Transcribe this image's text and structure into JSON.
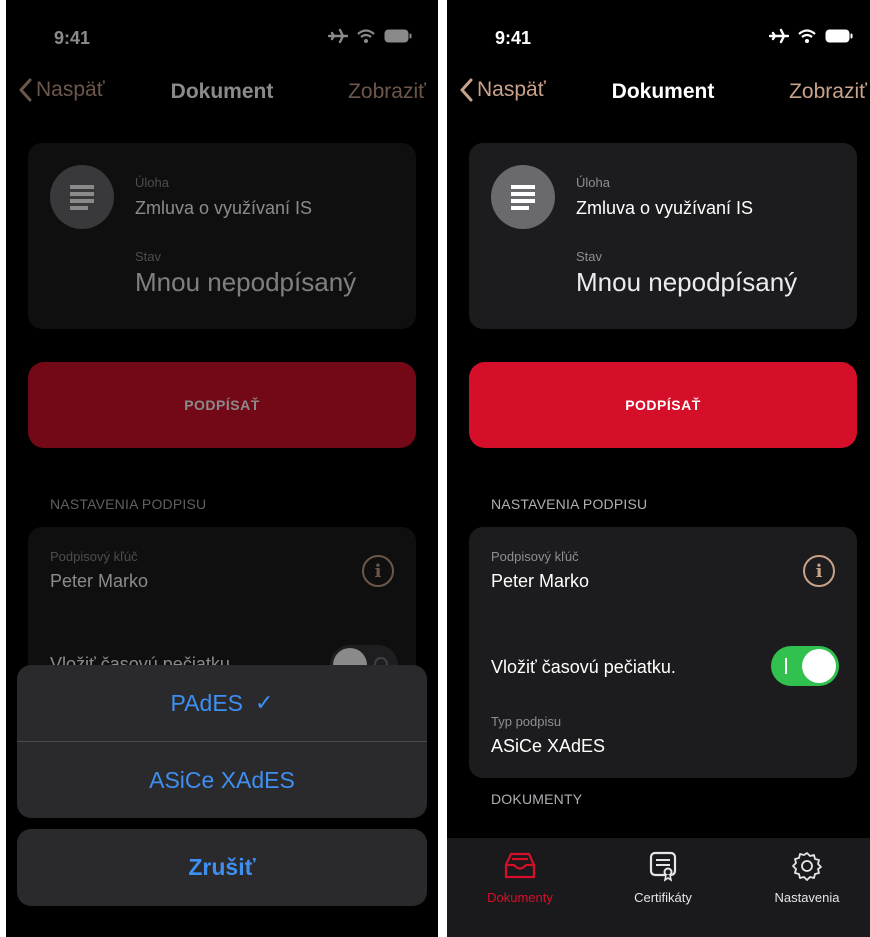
{
  "status_bar": {
    "time": "9:41"
  },
  "nav": {
    "back_label": "Naspäť",
    "title": "Dokument",
    "right_label": "Zobraziť"
  },
  "document": {
    "task_label": "Úloha",
    "task_value": "Zmluva o využívaní IS",
    "state_label": "Stav",
    "state_value": "Mnou nepodpísaný"
  },
  "sign_button_label": "PODPÍSAŤ",
  "signature_settings": {
    "header": "NASTAVENIA PODPISU",
    "key_label": "Podpisový kľúč",
    "key_value": "Peter Marko",
    "timestamp_label": "Vložiť časovú pečiatku.",
    "type_label": "Typ podpisu",
    "type_value": "ASiCe XAdES"
  },
  "documents_header": "DOKUMENTY",
  "tabs": [
    {
      "label": "Dokumenty",
      "icon": "tray-icon",
      "active": true
    },
    {
      "label": "Certifikáty",
      "icon": "certificate-icon",
      "active": false
    },
    {
      "label": "Nastavenia",
      "icon": "gear-icon",
      "active": false
    }
  ],
  "action_sheet": {
    "options": [
      {
        "label": "PAdES",
        "selected": true
      },
      {
        "label": "ASiCe XAdES",
        "selected": false
      }
    ],
    "selected_mark": "✓",
    "cancel_label": "Zrušiť"
  },
  "left_timestamp_toggle_on": false,
  "right_timestamp_toggle_on": true,
  "colors": {
    "accent_red": "#d50f2a",
    "nav_tint": "#c9a28a",
    "sheet_blue": "#3f8ff0",
    "toggle_on": "#30c14e"
  }
}
